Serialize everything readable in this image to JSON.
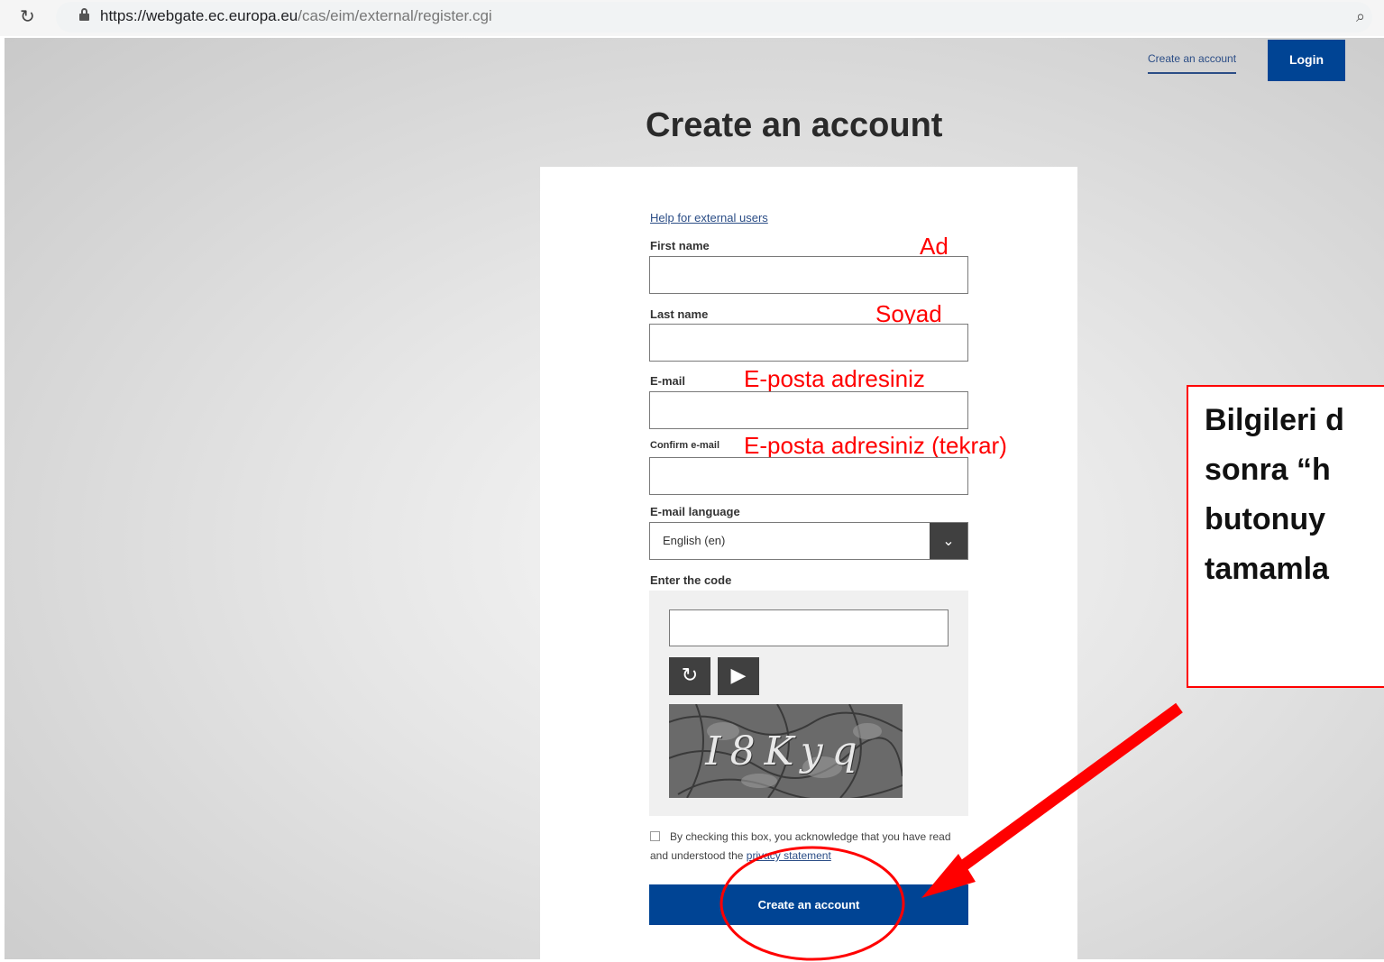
{
  "browser": {
    "url_host": "https://webgate.ec.europa.eu",
    "url_path": "/cas/eim/external/register.cgi"
  },
  "header": {
    "create_account_link": "Create an account",
    "login_label": "Login"
  },
  "form": {
    "title": "Create an account",
    "help_link": "Help for external users",
    "fields": [
      {
        "label": "First name",
        "value": "",
        "annotation": "Ad"
      },
      {
        "label": "Last name",
        "value": "",
        "annotation": "Soyad"
      },
      {
        "label": "E-mail",
        "value": "",
        "annotation": "E-posta adresiniz"
      },
      {
        "label": "Confirm e-mail",
        "value": "",
        "annotation": "E-posta adresiniz (tekrar)"
      }
    ],
    "language_label": "E-mail language",
    "language_value": "English (en)",
    "code_label": "Enter the code",
    "captcha_text": "I8Kyq",
    "privacy_text": "By checking this box, you acknowledge that you have read and understood the",
    "privacy_link": "privacy statement",
    "submit_label": "Create an account"
  },
  "annotation_note": {
    "lines": [
      "Bilgileri d",
      "sonra “h",
      "butonuy",
      "tamamla"
    ]
  },
  "colors": {
    "brand_blue": "#004494",
    "annotation_red": "#ff0000"
  }
}
